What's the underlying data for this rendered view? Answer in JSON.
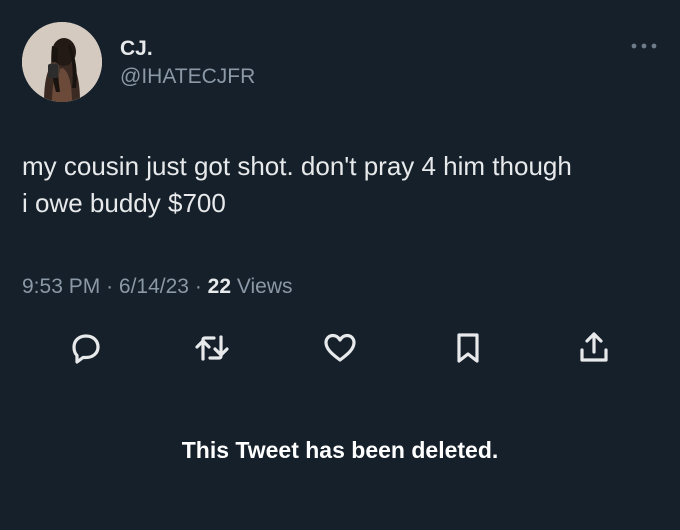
{
  "user": {
    "display_name": "CJ.",
    "handle": "@IHATECJFR"
  },
  "tweet": {
    "text": "my cousin just got shot. don't pray 4 him though\ni owe buddy $700",
    "time": "9:53 PM",
    "separator": "·",
    "date": "6/14/23",
    "views_count": "22",
    "views_label": "Views"
  },
  "actions": [
    "reply-icon",
    "retweet-icon",
    "like-icon",
    "bookmark-icon",
    "share-icon"
  ],
  "notice": "This Tweet has been deleted.",
  "colors": {
    "background": "#15202b",
    "text_primary": "#e7e9ea",
    "text_secondary": "#8b98a5"
  }
}
